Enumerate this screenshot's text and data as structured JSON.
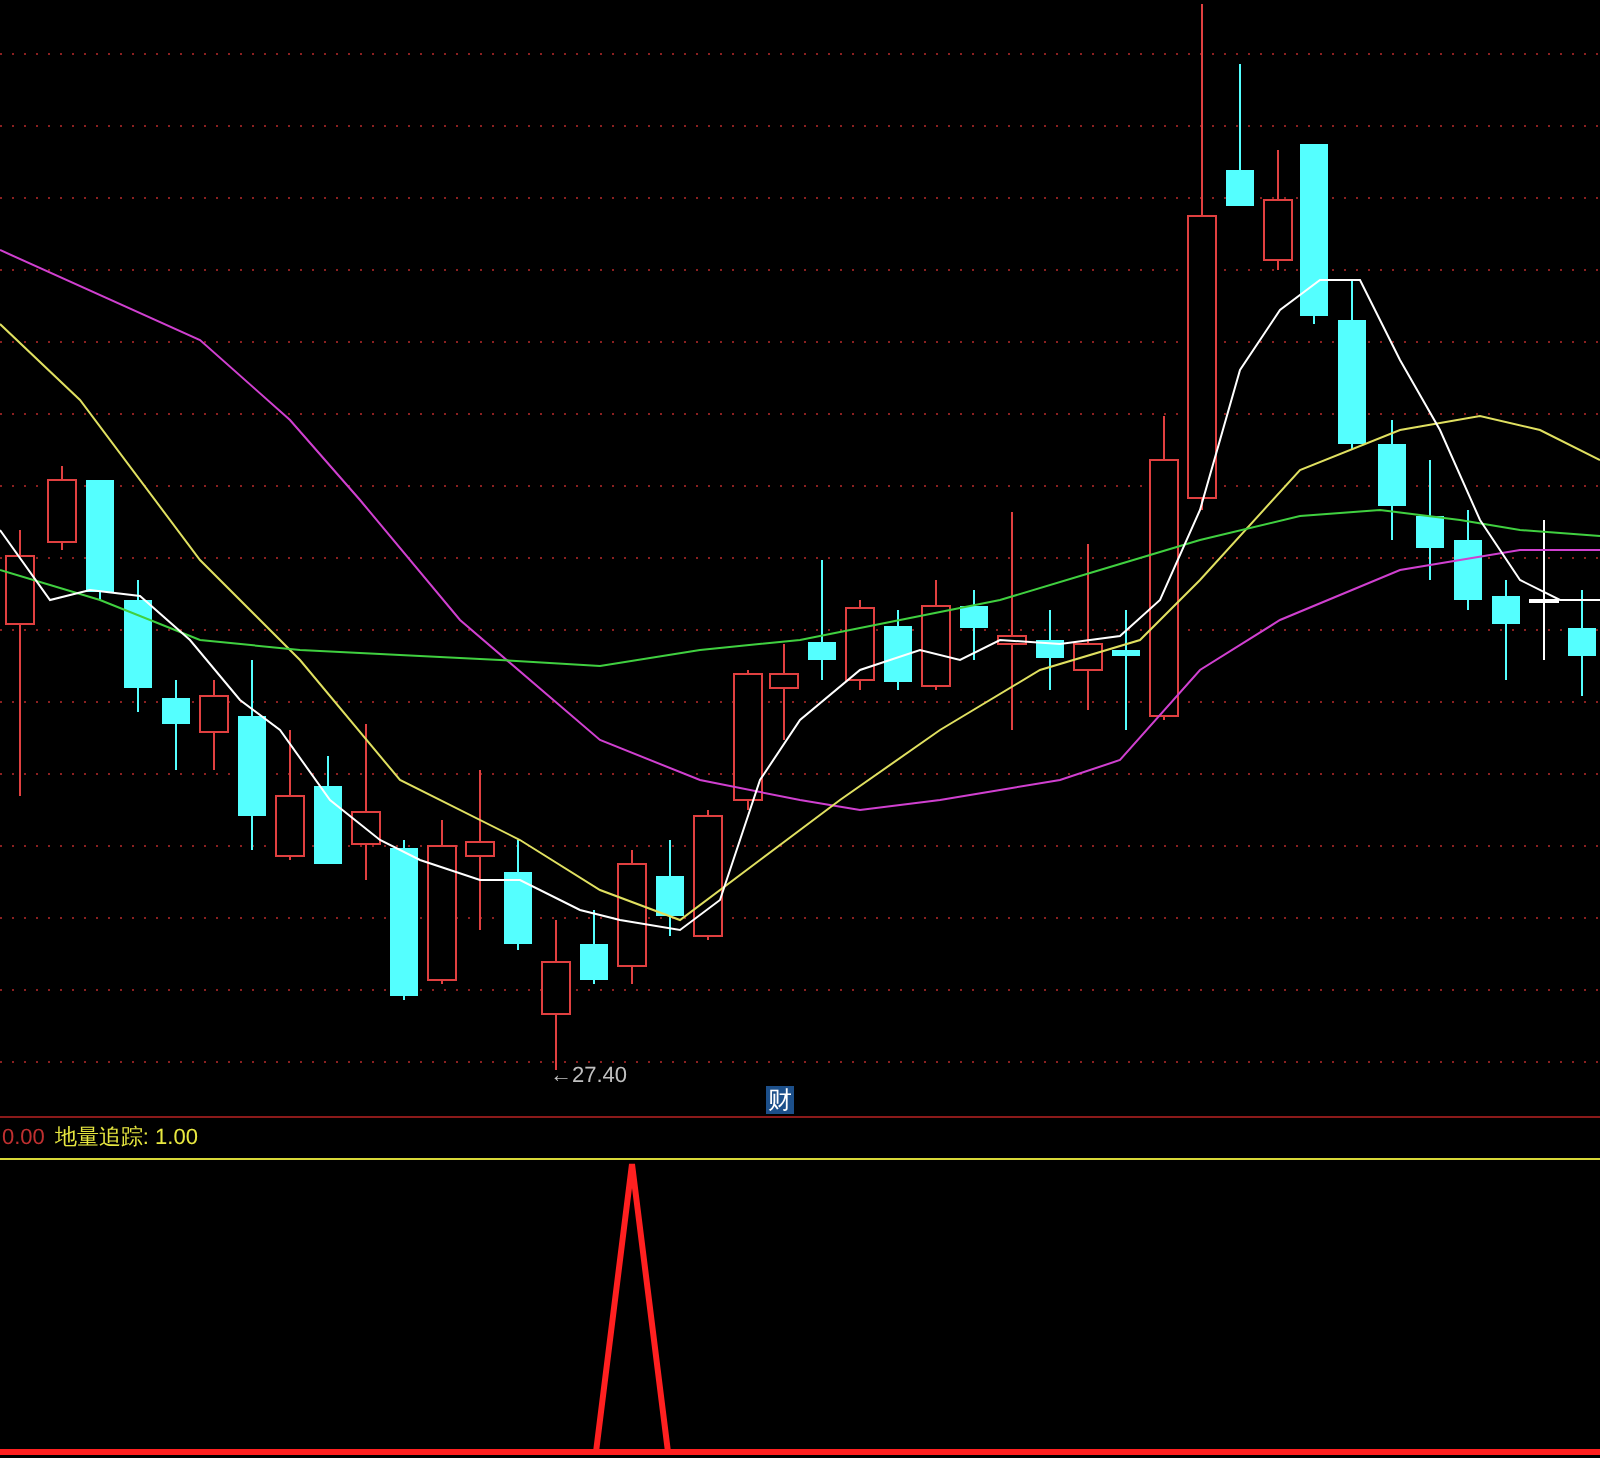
{
  "price_chart": {
    "low_marker": "←27.40",
    "event_badge": "财"
  },
  "indicator_panel": {
    "scale_value": "0.00",
    "legend": "地量追踪: 1.00"
  }
}
